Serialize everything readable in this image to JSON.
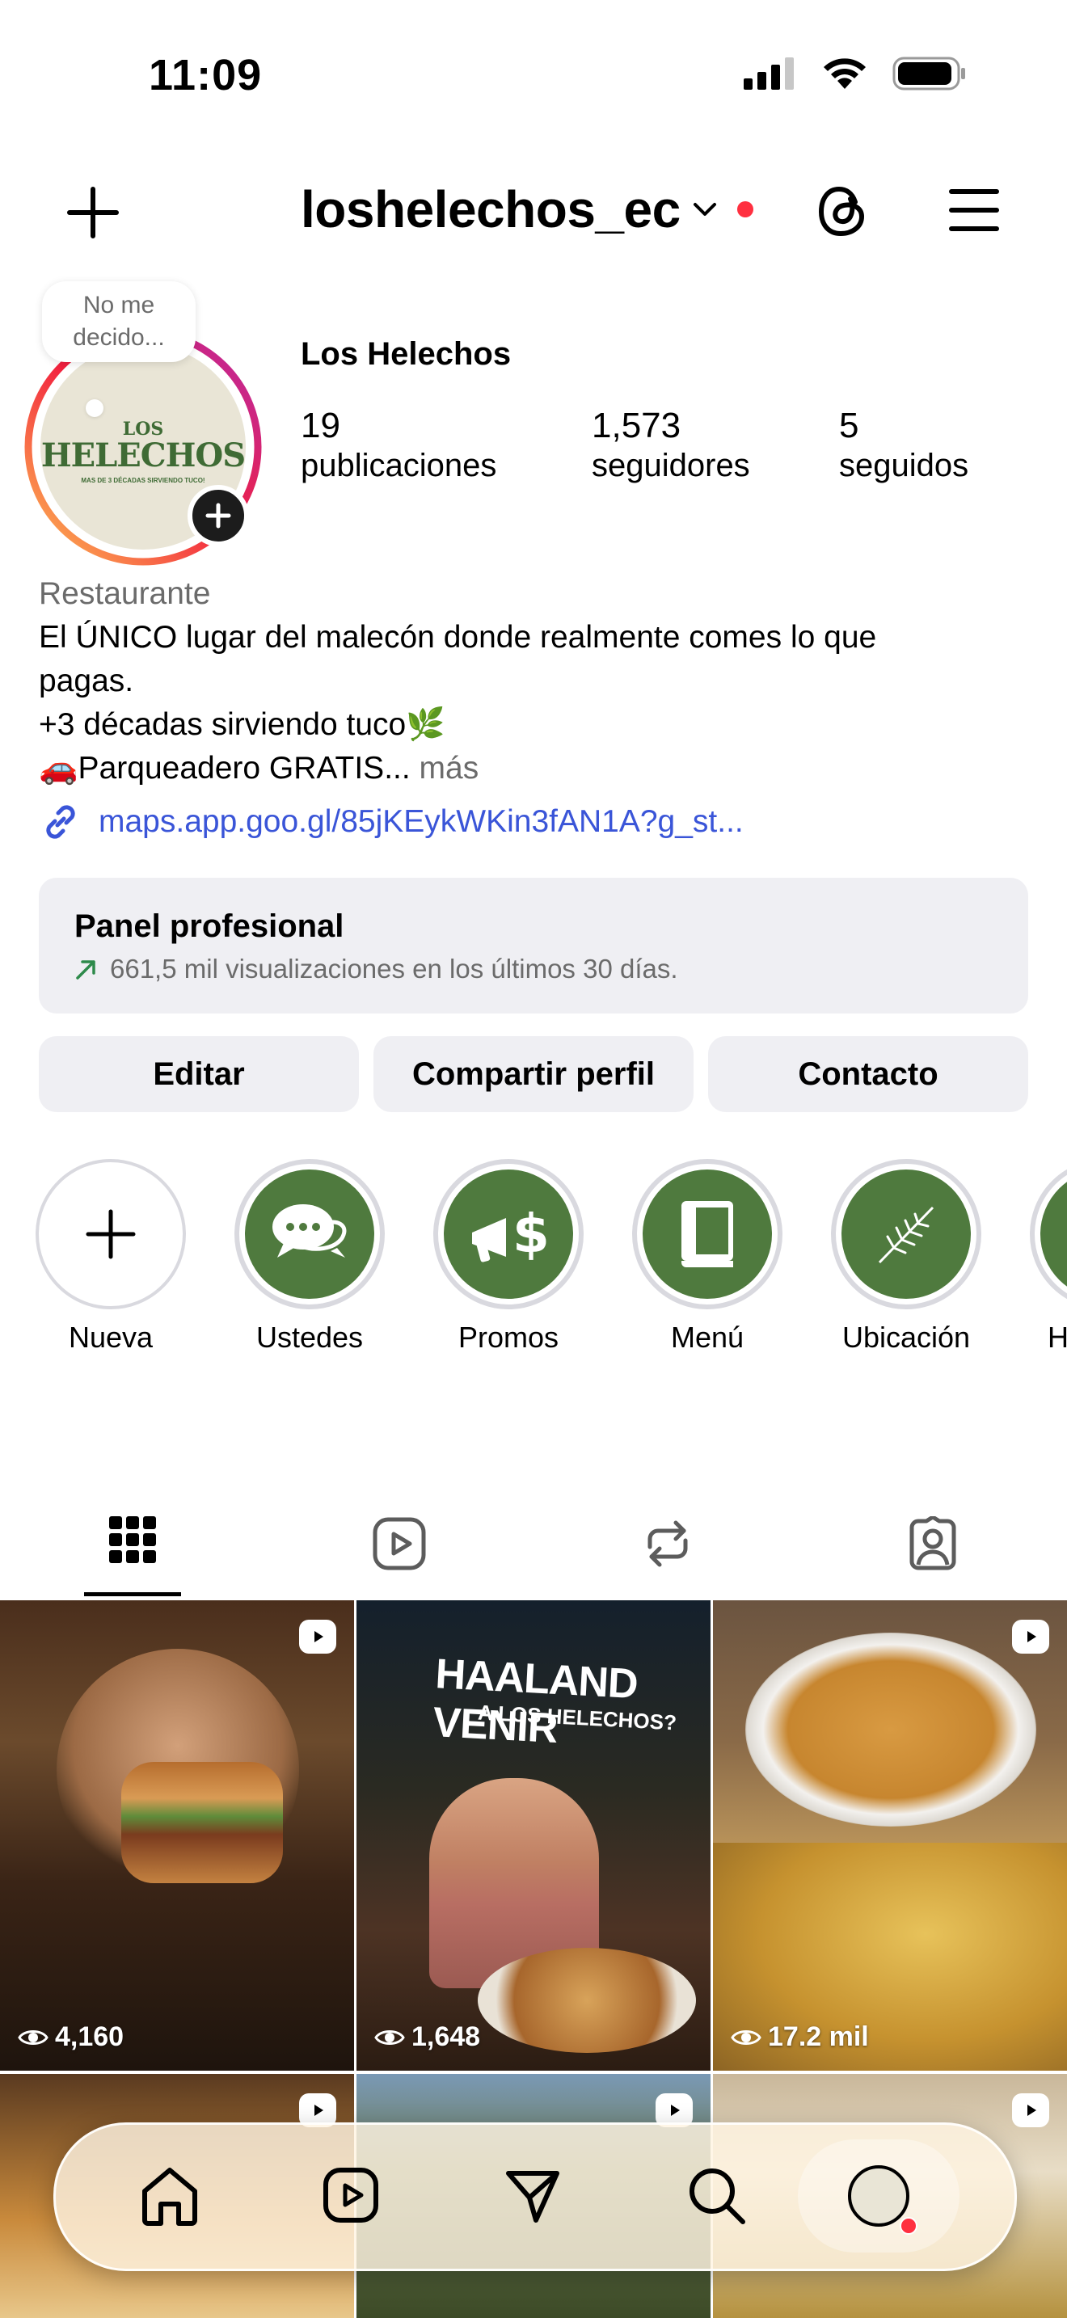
{
  "status": {
    "time": "11:09"
  },
  "header": {
    "username": "loshelechos_ec"
  },
  "profile": {
    "note": "No me decido...",
    "avatar_text_top": "LOS",
    "avatar_text_main": "HELECHOS",
    "avatar_text_sub": "MAS DE 3 DÉCADAS SIRVIENDO TUCO!",
    "display_name": "Los Helechos",
    "stats": [
      {
        "value": "19",
        "label": "publicaciones"
      },
      {
        "value": "1,573",
        "label": "seguidores"
      },
      {
        "value": "5",
        "label": "seguidos"
      }
    ],
    "category": "Restaurante",
    "bio_line1": "El ÚNICO lugar del malecón donde realmente comes lo que",
    "bio_line2": "pagas.",
    "bio_line3": "+3 décadas sirviendo tuco🌿",
    "bio_line4": "🚗Parqueadero GRATIS...",
    "more": "más",
    "link": "maps.app.goo.gl/85jKEykWKin3fAN1A?g_st..."
  },
  "dashboard": {
    "title": "Panel profesional",
    "subtitle": "661,5 mil visualizaciones en los últimos 30 días."
  },
  "actions": {
    "edit": "Editar",
    "share": "Compartir perfil",
    "contact": "Contacto"
  },
  "highlights": [
    {
      "label": "Nueva",
      "icon": "plus-icon"
    },
    {
      "label": "Ustedes",
      "icon": "chat-bubbles-icon"
    },
    {
      "label": "Promos",
      "icon": "megaphone-dollar-icon"
    },
    {
      "label": "Menú",
      "icon": "book-icon"
    },
    {
      "label": "Ubicación",
      "icon": "fern-leaf-icon"
    },
    {
      "label": "H",
      "icon": "highlight-icon"
    }
  ],
  "tabs": [
    "grid-icon",
    "reels-icon",
    "reposts-icon",
    "tagged-icon"
  ],
  "posts": [
    {
      "views": "4,160"
    },
    {
      "views": "1,648",
      "overlay_line1": "HAALAND VENIR",
      "overlay_line2": "A LOS HELECHOS?"
    },
    {
      "views": "17.2 mil"
    }
  ],
  "bottom_nav": [
    "home-icon",
    "reels-icon",
    "messages-icon",
    "search-icon",
    "profile-avatar-icon"
  ]
}
